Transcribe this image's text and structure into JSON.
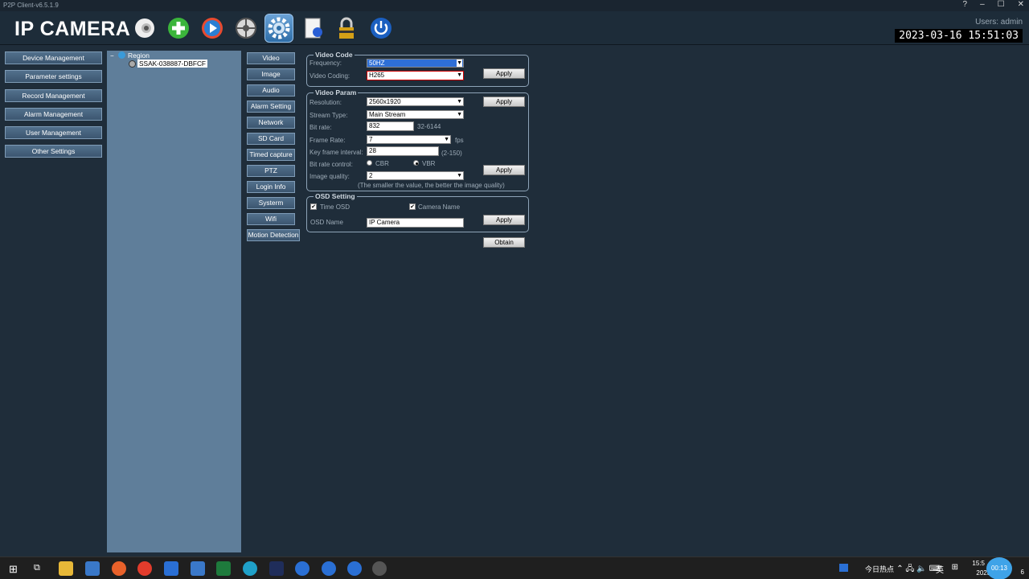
{
  "window": {
    "title": "P2P Client-v6.5.1.9"
  },
  "header": {
    "logo": "IP CAMERA",
    "users": "Users: admin",
    "clock": "2023-03-16 15:51:03",
    "tools": [
      "camera-icon",
      "add-icon",
      "play-icon",
      "ptz-icon",
      "settings-icon",
      "config-icon",
      "lock-icon",
      "power-icon"
    ]
  },
  "leftnav": [
    "Device Management",
    "Parameter settings",
    "Record Management",
    "Alarm Management",
    "User Management",
    "Other Settings"
  ],
  "tree": {
    "region": "Region",
    "device": "SSAK-038887-DBFCF"
  },
  "tabs": [
    "Video",
    "Image",
    "Audio",
    "Alarm Setting",
    "Network",
    "SD Card",
    "Timed capture",
    "PTZ",
    "Login Info",
    "Systerm",
    "Wifi",
    "Motion Detection"
  ],
  "video_code": {
    "title": "Video Code",
    "frequency_label": "Frequency:",
    "frequency": "50HZ",
    "coding_label": "Video Coding:",
    "coding": "H265",
    "apply": "Apply"
  },
  "video_param": {
    "title": "Video Param",
    "resolution_label": "Resolution:",
    "resolution": "2560x1920",
    "stream_label": "Stream Type:",
    "stream": "Main Stream",
    "bitrate_label": "Bit rate:",
    "bitrate": "832",
    "bitrate_range": "32-6144",
    "framerate_label": "Frame Rate:",
    "framerate": "7",
    "fps": "fps",
    "keyframe_label": "Key frame interval:",
    "keyframe": "28",
    "keyframe_range": "(2-150)",
    "brc_label": "Bit rate control:",
    "cbr": "CBR",
    "vbr": "VBR",
    "quality_label": "Image quality:",
    "quality": "2",
    "quality_hint": "(The smaller the value, the better the image quality)",
    "apply1": "Apply",
    "apply2": "Apply"
  },
  "osd": {
    "title": "OSD Setting",
    "time_osd": "Time OSD",
    "camera_name": "Camera Name",
    "name_label": "OSD Name",
    "name": "IP Camera",
    "apply": "Apply",
    "obtain": "Obtain"
  },
  "taskbar": {
    "news": "今日热点",
    "ime": "英",
    "time": "15:5",
    "date": "2023/3/16",
    "badge": "00:13"
  }
}
